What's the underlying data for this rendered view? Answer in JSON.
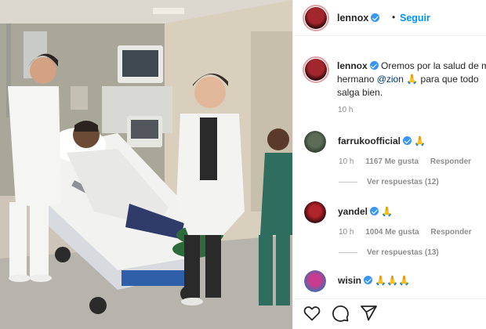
{
  "post": {
    "username": "lennox",
    "separator": "•",
    "follow_label": "Seguir",
    "caption_user": "lennox",
    "caption_line1": "Oremos por la salud de m",
    "caption_line2_pre": "hermano ",
    "caption_mention": "@zion",
    "caption_line2_post": " 🙏 para que todo",
    "caption_line3": "salga bien.",
    "caption_time": "10 h"
  },
  "comments": [
    {
      "user": "farrukoofficial",
      "text": "🙏",
      "time": "10 h",
      "likes": "1167 Me gusta",
      "reply": "Responder",
      "view_replies": "Ver respuestas (12)"
    },
    {
      "user": "yandel",
      "text": "🙏",
      "time": "10 h",
      "likes": "1004 Me gusta",
      "reply": "Responder",
      "view_replies": "Ver respuestas (13)"
    },
    {
      "user": "wisin",
      "text": "🙏🙏🙏"
    }
  ],
  "icons": {
    "like": "heart-icon",
    "comment": "comment-icon",
    "share": "share-icon"
  },
  "colors": {
    "link_blue": "#0095f6",
    "verified_blue": "#3897f0",
    "text": "#262626",
    "muted": "#8e8e8e"
  }
}
